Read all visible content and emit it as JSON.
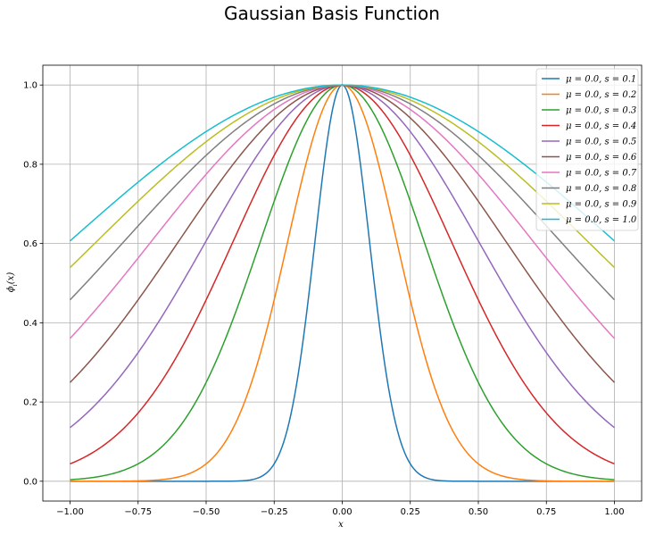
{
  "chart_data": {
    "type": "line",
    "title": "Gaussian Basis Function",
    "xlabel": "x",
    "ylabel": "ϕ_i(x)",
    "xlim": [
      -1.1,
      1.1
    ],
    "ylim": [
      -0.05,
      1.05
    ],
    "xticks": [
      -1.0,
      -0.75,
      -0.5,
      -0.25,
      0.0,
      0.25,
      0.5,
      0.75,
      1.0
    ],
    "xtick_labels": [
      "−1.00",
      "−0.75",
      "−0.50",
      "−0.25",
      "0.00",
      "0.25",
      "0.50",
      "0.75",
      "1.00"
    ],
    "yticks": [
      0.0,
      0.2,
      0.4,
      0.6,
      0.8,
      1.0
    ],
    "ytick_labels": [
      "0.0",
      "0.2",
      "0.4",
      "0.6",
      "0.8",
      "1.0"
    ],
    "grid": true,
    "legend_position": "top-right",
    "function": "exp(-(x - mu)^2 / (2 s^2))",
    "x_range": [
      -1.0,
      1.0
    ],
    "series": [
      {
        "name": "μ = 0.0, s = 0.1",
        "mu": 0.0,
        "s": 0.1,
        "color": "#1f77b4"
      },
      {
        "name": "μ = 0.0, s = 0.2",
        "mu": 0.0,
        "s": 0.2,
        "color": "#ff7f0e"
      },
      {
        "name": "μ = 0.0, s = 0.3",
        "mu": 0.0,
        "s": 0.3,
        "color": "#2ca02c"
      },
      {
        "name": "μ = 0.0, s = 0.4",
        "mu": 0.0,
        "s": 0.4,
        "color": "#d62728"
      },
      {
        "name": "μ = 0.0, s = 0.5",
        "mu": 0.0,
        "s": 0.5,
        "color": "#9467bd"
      },
      {
        "name": "μ = 0.0, s = 0.6",
        "mu": 0.0,
        "s": 0.6,
        "color": "#8c564b"
      },
      {
        "name": "μ = 0.0, s = 0.7",
        "mu": 0.0,
        "s": 0.7,
        "color": "#e377c2"
      },
      {
        "name": "μ = 0.0, s = 0.8",
        "mu": 0.0,
        "s": 0.8,
        "color": "#7f7f7f"
      },
      {
        "name": "μ = 0.0, s = 0.9",
        "mu": 0.0,
        "s": 0.9,
        "color": "#bcbd22"
      },
      {
        "name": "μ = 0.0, s = 1.0",
        "mu": 0.0,
        "s": 1.0,
        "color": "#17becf"
      }
    ]
  }
}
